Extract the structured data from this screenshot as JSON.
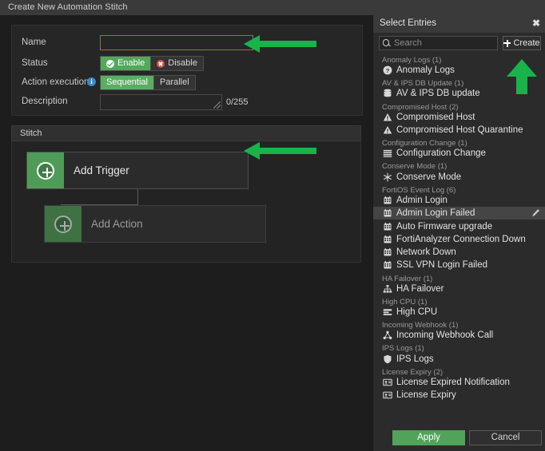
{
  "window": {
    "title": "Create New Automation Stitch"
  },
  "form": {
    "name": {
      "label": "Name",
      "value": "",
      "placeholder": ""
    },
    "status": {
      "label": "Status",
      "options": [
        "Enable",
        "Disable"
      ],
      "selected": "Enable"
    },
    "action_execution": {
      "label": "Action execution",
      "info_icon": "info-icon",
      "options": [
        "Sequential",
        "Parallel"
      ],
      "selected": "Sequential"
    },
    "description": {
      "label": "Description",
      "value": "",
      "counter": "0/255"
    }
  },
  "stitch": {
    "header": "Stitch",
    "trigger": {
      "label": "Add Trigger",
      "icon": "plus-circle-icon"
    },
    "action": {
      "label": "Add Action",
      "icon": "plus-circle-icon"
    }
  },
  "select_entries": {
    "title": "Select Entries",
    "close_icon": "close-icon",
    "search": {
      "placeholder": "Search",
      "value": "",
      "icon": "search-icon"
    },
    "create_button": {
      "label": "Create",
      "icon": "plus-icon"
    },
    "groups": [
      {
        "name": "Anomaly Logs (1)",
        "items": [
          {
            "label": "Anomaly Logs",
            "icon": "question-circle-icon",
            "selected": false
          }
        ]
      },
      {
        "name": "AV & IPS DB Update (1)",
        "items": [
          {
            "label": "AV & IPS DB update",
            "icon": "database-icon",
            "selected": false
          }
        ]
      },
      {
        "name": "Compromised Host (2)",
        "items": [
          {
            "label": "Compromised Host",
            "icon": "warning-triangle-icon",
            "selected": false
          },
          {
            "label": "Compromised Host Quarantine",
            "icon": "warning-triangle-icon",
            "selected": false
          }
        ]
      },
      {
        "name": "Configuration Change (1)",
        "items": [
          {
            "label": "Configuration Change",
            "icon": "list-icon",
            "selected": false
          }
        ]
      },
      {
        "name": "Conserve Mode (1)",
        "items": [
          {
            "label": "Conserve Mode",
            "icon": "snowflake-icon",
            "selected": false
          }
        ]
      },
      {
        "name": "FortiOS Event Log (6)",
        "items": [
          {
            "label": "Admin Login",
            "icon": "event-log-icon",
            "selected": false
          },
          {
            "label": "Admin Login Failed",
            "icon": "event-log-icon",
            "selected": true,
            "edit_icon": "pencil-icon"
          },
          {
            "label": "Auto Firmware upgrade",
            "icon": "event-log-icon",
            "selected": false
          },
          {
            "label": "FortiAnalyzer Connection Down",
            "icon": "event-log-icon",
            "selected": false
          },
          {
            "label": "Network Down",
            "icon": "event-log-icon",
            "selected": false
          },
          {
            "label": "SSL VPN Login Failed",
            "icon": "event-log-icon",
            "selected": false
          }
        ]
      },
      {
        "name": "HA Failover (1)",
        "items": [
          {
            "label": "HA Failover",
            "icon": "sitemap-icon",
            "selected": false
          }
        ]
      },
      {
        "name": "High CPU (1)",
        "items": [
          {
            "label": "High CPU",
            "icon": "cpu-bars-icon",
            "selected": false
          }
        ]
      },
      {
        "name": "Incoming Webhook (1)",
        "items": [
          {
            "label": "Incoming Webhook Call",
            "icon": "share-nodes-icon",
            "selected": false
          }
        ]
      },
      {
        "name": "IPS Logs (1)",
        "items": [
          {
            "label": "IPS Logs",
            "icon": "shield-icon",
            "selected": false
          }
        ]
      },
      {
        "name": "License Expiry (2)",
        "items": [
          {
            "label": "License Expired Notification",
            "icon": "license-card-icon",
            "selected": false
          },
          {
            "label": "License Expiry",
            "icon": "license-card-icon",
            "selected": false
          }
        ]
      }
    ],
    "footer": {
      "apply": "Apply",
      "cancel": "Cancel"
    }
  },
  "annotations": [
    {
      "name": "arrow-left-name-field",
      "direction": "left"
    },
    {
      "name": "arrow-left-add-trigger",
      "direction": "left"
    },
    {
      "name": "arrow-up-create-button",
      "direction": "up"
    }
  ],
  "colors": {
    "accent_green": "#50a359",
    "annotation_green": "#18b44a",
    "danger_red": "#d94b4b",
    "focus_border": "#97732f",
    "panel_bg": "#2b2b2b",
    "app_bg": "#1d1d1d"
  }
}
